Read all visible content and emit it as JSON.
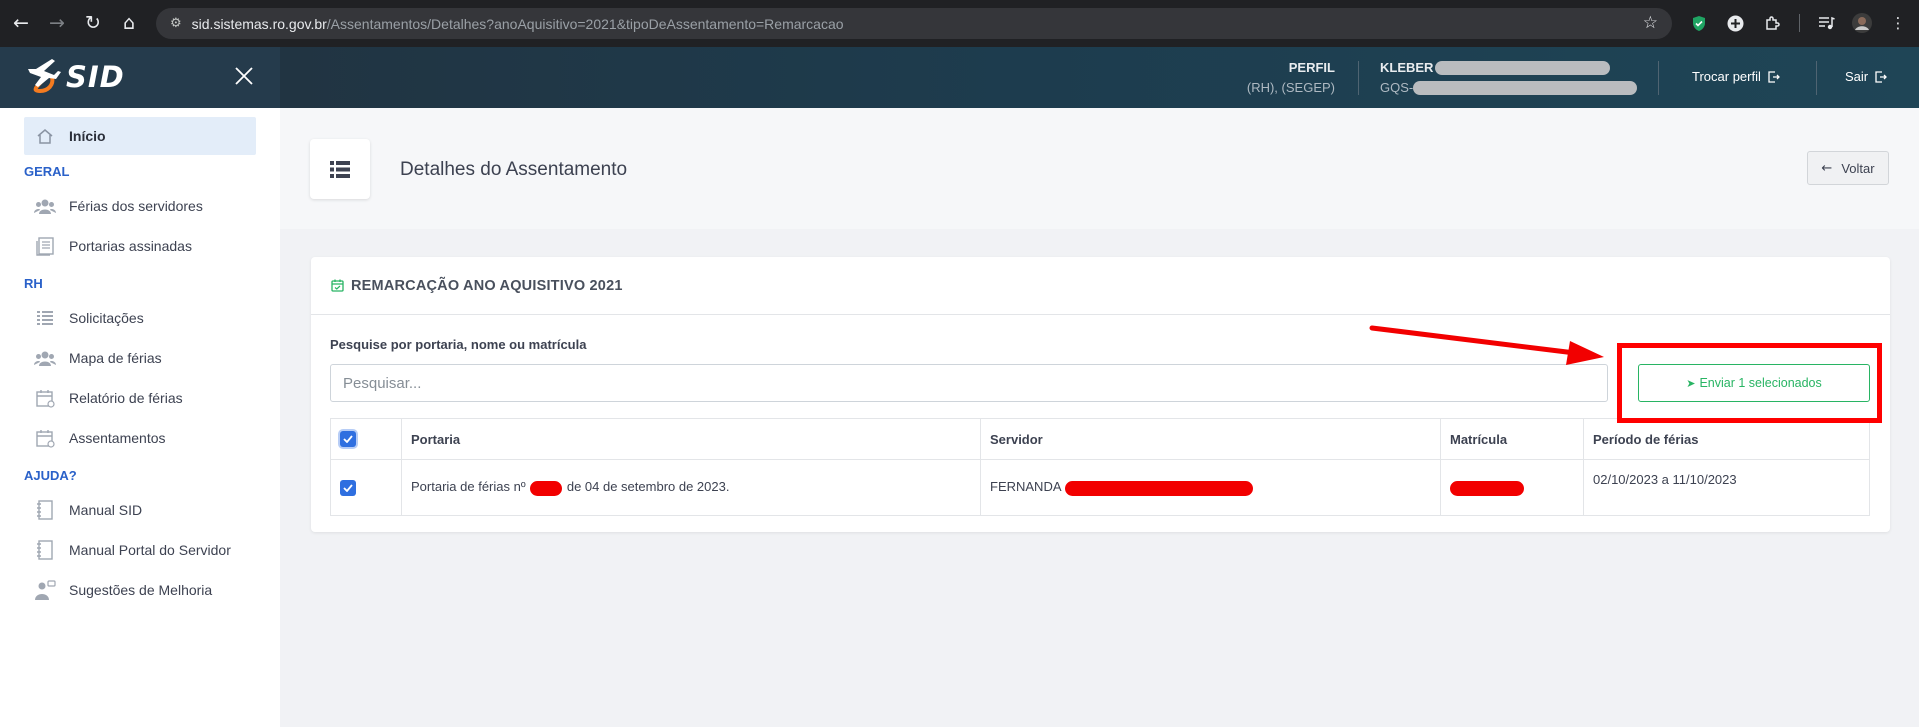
{
  "browser": {
    "url_host": "sid.sistemas.ro.gov.br",
    "url_path": "/Assentamentos/Detalhes?anoAquisitivo=2021&tipoDeAssentamento=Remarcacao",
    "icons": [
      "back-icon",
      "forward-icon",
      "reload-icon",
      "home-icon",
      "site-info-icon",
      "bookmark-star-icon",
      "shield-extension-icon",
      "add-extension-icon",
      "extensions-puzzle-icon",
      "media-controls-icon",
      "profile-avatar-icon",
      "menu-kebab-icon"
    ]
  },
  "app": {
    "logo_text": "SID",
    "accent_color": "#2a61c9",
    "brand_orange": "#f47b20"
  },
  "sidebar": {
    "home_label": "Início",
    "sections": [
      {
        "title": "GERAL",
        "items": [
          {
            "label": "Férias dos servidores",
            "icon": "users-icon"
          },
          {
            "label": "Portarias assinadas",
            "icon": "document-icon"
          }
        ]
      },
      {
        "title": "RH",
        "items": [
          {
            "label": "Solicitações",
            "icon": "list-icon"
          },
          {
            "label": "Mapa de férias",
            "icon": "users-icon"
          },
          {
            "label": "Relatório de férias",
            "icon": "calendar-icon"
          },
          {
            "label": "Assentamentos",
            "icon": "calendar-icon"
          }
        ]
      },
      {
        "title": "AJUDA?",
        "items": [
          {
            "label": "Manual SID",
            "icon": "book-icon"
          },
          {
            "label": "Manual Portal do Servidor",
            "icon": "book-icon"
          },
          {
            "label": "Sugestões de Melhoria",
            "icon": "feedback-icon"
          }
        ]
      }
    ]
  },
  "header": {
    "perfil_label": "PERFIL",
    "perfil_value": "(RH), (SEGEP)",
    "user_name": "KLEBER",
    "user_org": "GQS-",
    "switch_profile": "Trocar perfil",
    "logout": "Sair"
  },
  "page": {
    "title": "Detalhes do Assentamento",
    "back_label": "Voltar"
  },
  "card": {
    "title": "REMARCAÇÃO ANO AQUISITIVO 2021",
    "search_label": "Pesquise por portaria, nome ou matrícula",
    "search_placeholder": "Pesquisar...",
    "send_button": "Enviar 1 selecionados",
    "send_color": "#28b463",
    "table": {
      "columns": [
        "Portaria",
        "Servidor",
        "Matrícula",
        "Período de férias"
      ],
      "rows": [
        {
          "checked": true,
          "portaria_prefix": "Portaria de férias nº",
          "portaria_suffix": "de 04 de setembro de 2023.",
          "servidor": "FERNANDA",
          "periodo": "02/10/2023 a 11/10/2023"
        }
      ]
    }
  }
}
